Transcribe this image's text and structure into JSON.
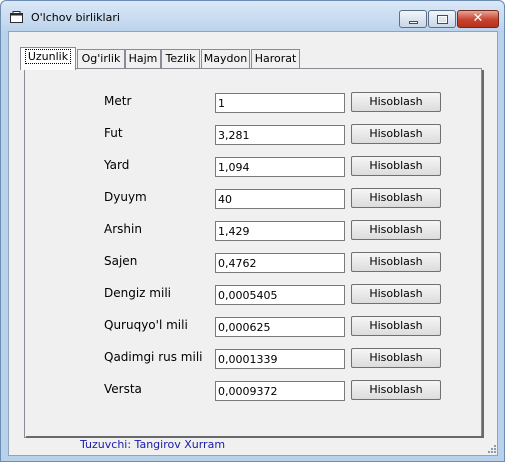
{
  "window": {
    "title": "O'lchov birliklari",
    "min_glyph": "",
    "close_glyph": "✕"
  },
  "tabs": [
    {
      "label": "Uzunlik",
      "active": true
    },
    {
      "label": "Og'irlik",
      "active": false
    },
    {
      "label": "Hajm",
      "active": false
    },
    {
      "label": "Tezlik",
      "active": false
    },
    {
      "label": "Maydon",
      "active": false
    },
    {
      "label": "Harorat",
      "active": false
    }
  ],
  "rows": [
    {
      "label": "Metr",
      "value": "1",
      "button": "Hisoblash"
    },
    {
      "label": "Fut",
      "value": "3,281",
      "button": "Hisoblash"
    },
    {
      "label": "Yard",
      "value": "1,094",
      "button": "Hisoblash"
    },
    {
      "label": "Dyuym",
      "value": "40",
      "button": "Hisoblash"
    },
    {
      "label": "Arshin",
      "value": "1,429",
      "button": "Hisoblash"
    },
    {
      "label": "Sajen",
      "value": "0,4762",
      "button": "Hisoblash"
    },
    {
      "label": "Dengiz mili",
      "value": "0,0005405",
      "button": "Hisoblash"
    },
    {
      "label": "Quruqyo'l mili",
      "value": "0,000625",
      "button": "Hisoblash"
    },
    {
      "label": "Qadimgi rus mili",
      "value": "0,0001339",
      "button": "Hisoblash"
    },
    {
      "label": "Versta",
      "value": "0,0009372",
      "button": "Hisoblash"
    }
  ],
  "footer": {
    "credit": "Tuzuvchi: Tangirov Xurram"
  },
  "colors": {
    "credit_text": "#1a1aa8",
    "close_button": "#c8432d",
    "frame": "#b9d1ea"
  }
}
